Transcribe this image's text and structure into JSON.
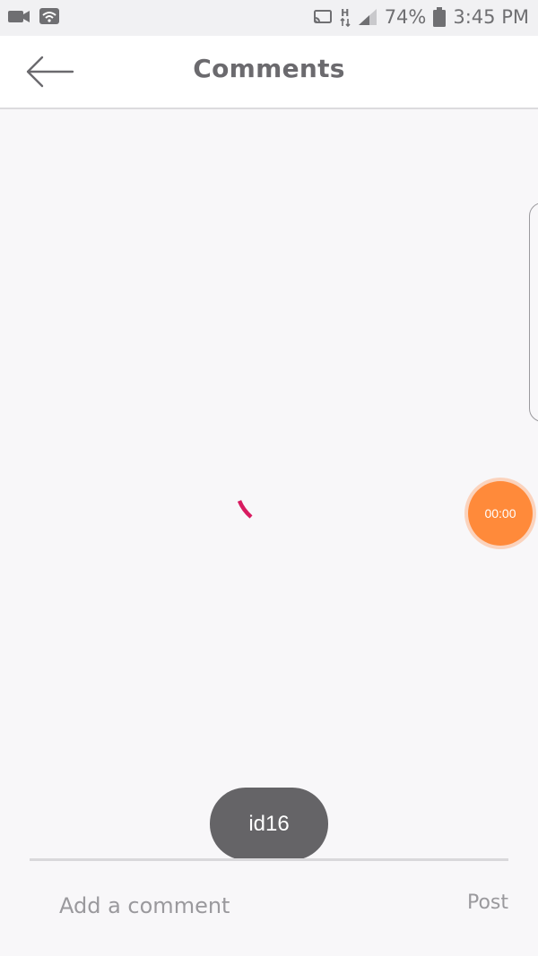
{
  "status_bar": {
    "battery_percent": "74%",
    "time": "3:45 PM",
    "network_label": "H",
    "icons": [
      "video-camera-icon",
      "wifi-icon",
      "cast-icon",
      "data-arrows-icon",
      "signal-icon",
      "battery-icon"
    ]
  },
  "header": {
    "title": "Comments",
    "back_icon": "back-arrow-icon"
  },
  "timer": {
    "label": "00:00",
    "color": "#ff8a3a"
  },
  "toast": {
    "text": "id16"
  },
  "comment_box": {
    "placeholder": "Add a comment",
    "value": "",
    "post_label": "Post"
  },
  "colors": {
    "spinner": "#d81b60",
    "timer_bg": "#ff8a3a",
    "toast_bg": "#656467"
  }
}
